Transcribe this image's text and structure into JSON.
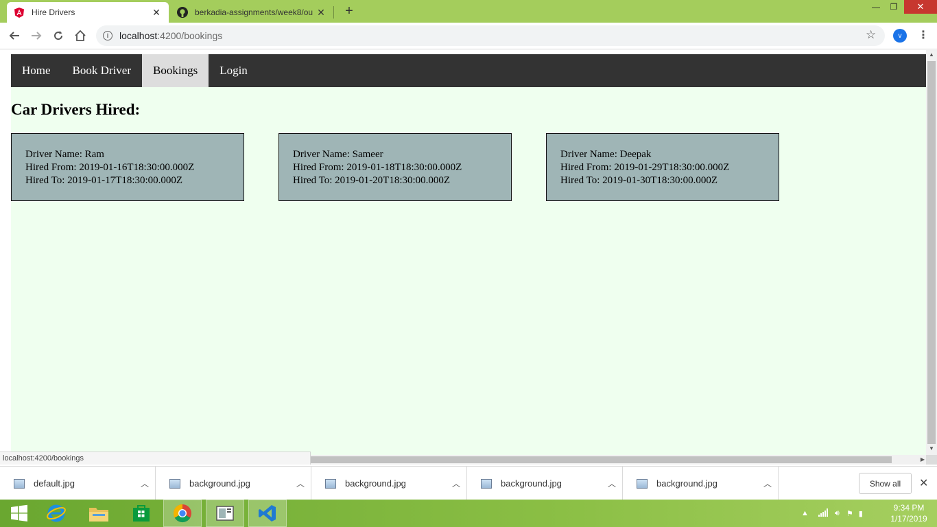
{
  "browser": {
    "tabs": [
      {
        "title": "Hire Drivers",
        "active": true,
        "icon": "angular-icon"
      },
      {
        "title": "berkadia-assignments/week8/ou",
        "active": false,
        "icon": "github-icon"
      }
    ],
    "url_host": "localhost",
    "url_path": ":4200/bookings",
    "profile_initial": "v",
    "status_url": "localhost:4200/bookings"
  },
  "nav": {
    "items": [
      {
        "label": "Home",
        "active": false
      },
      {
        "label": "Book Driver",
        "active": false
      },
      {
        "label": "Bookings",
        "active": true
      },
      {
        "label": "Login",
        "active": false
      }
    ]
  },
  "page": {
    "heading": "Car Drivers Hired:"
  },
  "bookings": [
    {
      "driver": "Driver Name: Ram",
      "from": "Hired From: 2019-01-16T18:30:00.000Z",
      "to": "Hired To: 2019-01-17T18:30:00.000Z"
    },
    {
      "driver": "Driver Name: Sameer",
      "from": "Hired From: 2019-01-18T18:30:00.000Z",
      "to": "Hired To: 2019-01-20T18:30:00.000Z"
    },
    {
      "driver": "Driver Name: Deepak",
      "from": "Hired From: 2019-01-29T18:30:00.000Z",
      "to": "Hired To: 2019-01-30T18:30:00.000Z"
    }
  ],
  "downloads": {
    "items": [
      "default.jpg",
      "background.jpg",
      "background.jpg",
      "background.jpg",
      "background.jpg"
    ],
    "show_all": "Show all"
  },
  "taskbar": {
    "time": "9:34 PM",
    "date": "1/17/2019"
  },
  "colors": {
    "nav_bg": "#333333",
    "nav_active_bg": "#dddddd",
    "page_bg": "#efffef",
    "card_bg": "#9fb5b6",
    "titlebar": "#a4cd5c"
  }
}
